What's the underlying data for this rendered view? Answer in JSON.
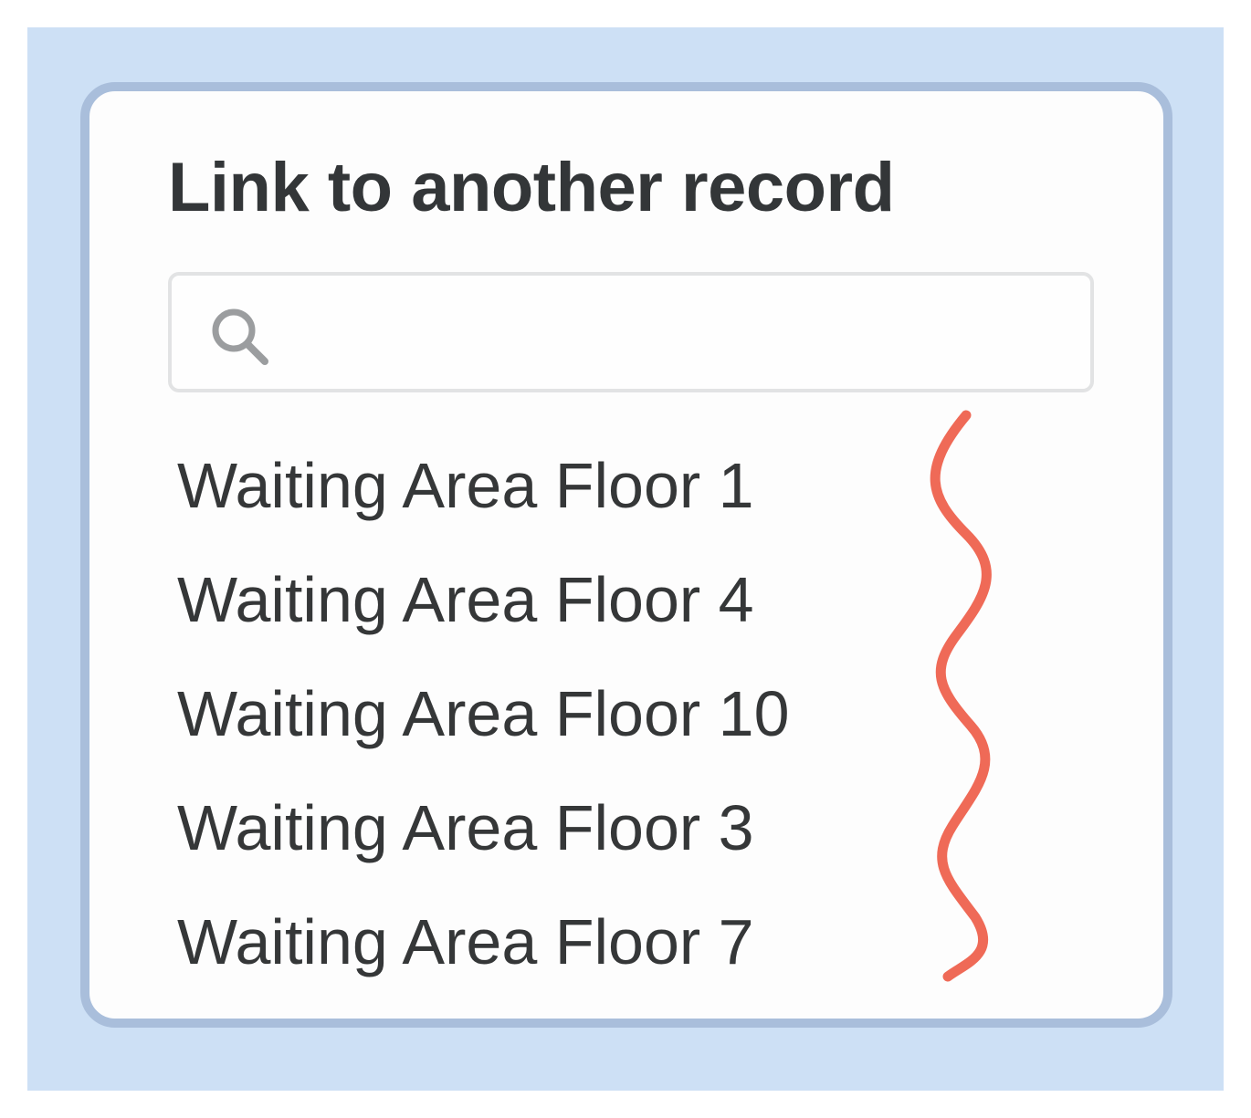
{
  "dialog": {
    "title": "Link to another record",
    "search": {
      "placeholder": "",
      "value": "",
      "icon": "search-icon"
    },
    "records": [
      {
        "label": "Waiting Area Floor 1"
      },
      {
        "label": "Waiting Area Floor 4"
      },
      {
        "label": "Waiting Area Floor 10"
      },
      {
        "label": "Waiting Area Floor 3"
      },
      {
        "label": "Waiting Area Floor 7"
      }
    ]
  },
  "colors": {
    "backdrop": "#cde0f5",
    "dialog_border": "#a9bedb",
    "text": "#353738",
    "annotation": "#ef6a57"
  }
}
